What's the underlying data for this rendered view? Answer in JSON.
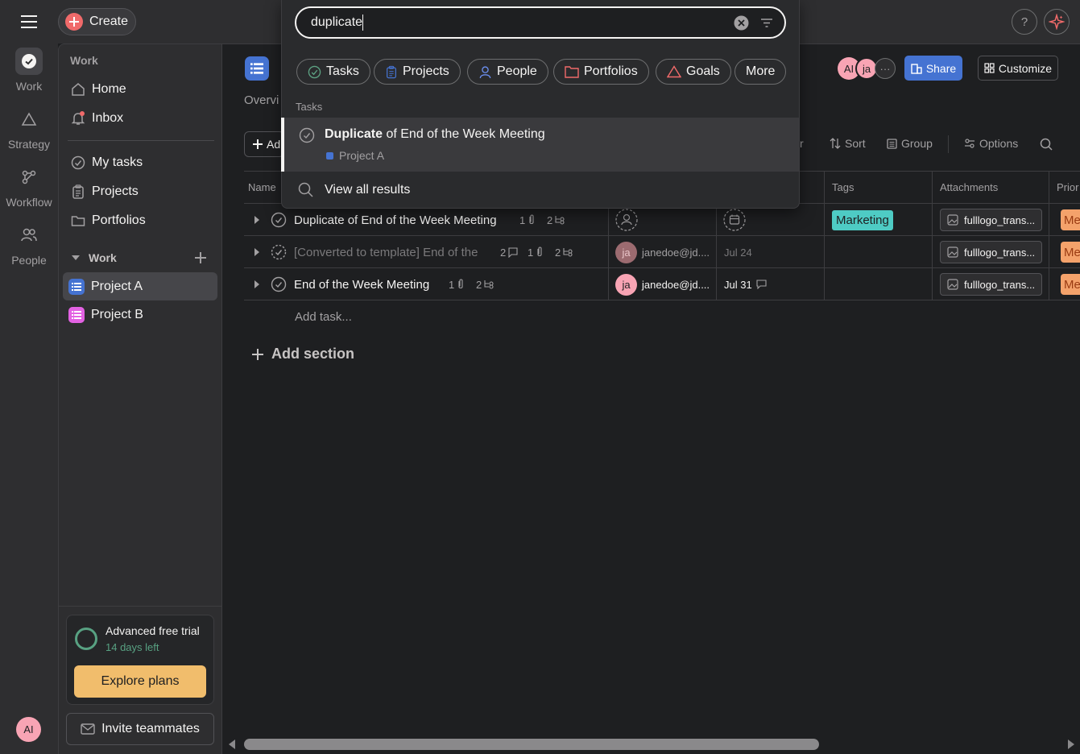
{
  "topbar": {
    "create_label": "Create",
    "help_label": "?"
  },
  "rail": {
    "items": [
      {
        "label": "Work"
      },
      {
        "label": "Strategy"
      },
      {
        "label": "Workflow"
      },
      {
        "label": "People"
      }
    ]
  },
  "sidebar": {
    "section_title": "Work",
    "nav": [
      {
        "label": "Home"
      },
      {
        "label": "Inbox"
      }
    ],
    "links": [
      {
        "label": "My tasks"
      },
      {
        "label": "Projects"
      },
      {
        "label": "Portfolios"
      }
    ],
    "work_group": "Work",
    "projects": [
      {
        "label": "Project A",
        "color": "#4573d2"
      },
      {
        "label": "Project B",
        "color": "#e362e3"
      }
    ],
    "trial_title": "Advanced free trial",
    "trial_sub": "14 days left",
    "explore_label": "Explore plans",
    "invite_label": "Invite teammates",
    "user_initials": "AI"
  },
  "project": {
    "tab_partial": "Overvi",
    "add_partial": "Ad",
    "members": [
      "AI",
      "ja"
    ],
    "share_label": "Share",
    "customize_label": "Customize",
    "toolbar": {
      "filter_partial": "r",
      "sort": "Sort",
      "group": "Group",
      "options": "Options"
    }
  },
  "grid": {
    "headers": {
      "name": "Name",
      "tags": "Tags",
      "attachments": "Attachments",
      "priority_partial": "Prior"
    },
    "rows": [
      {
        "name": "Duplicate of End of the Week Meeting",
        "attach_count": "1",
        "sub_count": "2",
        "comment_count": "",
        "assignee": "",
        "due": "",
        "tag": "Marketing",
        "attachment": "fulllogo_trans...",
        "priority": "Me"
      },
      {
        "name": "[Converted to template] End of the",
        "attach_count": "1",
        "sub_count": "2",
        "comment_count": "2",
        "assignee": "janedoe@jd....",
        "due": "Jul 24",
        "tag": "",
        "attachment": "fulllogo_trans...",
        "priority": "Me"
      },
      {
        "name": "End of the Week Meeting",
        "attach_count": "1",
        "sub_count": "2",
        "comment_count": "",
        "assignee": "janedoe@jd....",
        "due": "Jul 31",
        "tag": "",
        "attachment": "fulllogo_trans...",
        "priority": "Me"
      }
    ],
    "assignee_initials": "ja",
    "add_task": "Add task...",
    "add_section": "Add section"
  },
  "search": {
    "query": "duplicate",
    "chips": [
      {
        "label": "Tasks"
      },
      {
        "label": "Projects"
      },
      {
        "label": "People"
      },
      {
        "label": "Portfolios"
      },
      {
        "label": "Goals"
      },
      {
        "label": "More"
      }
    ],
    "section_label": "Tasks",
    "result_bold": "Duplicate",
    "result_rest": " of End of the Week Meeting",
    "result_project": "Project A",
    "view_all": "View all results"
  }
}
